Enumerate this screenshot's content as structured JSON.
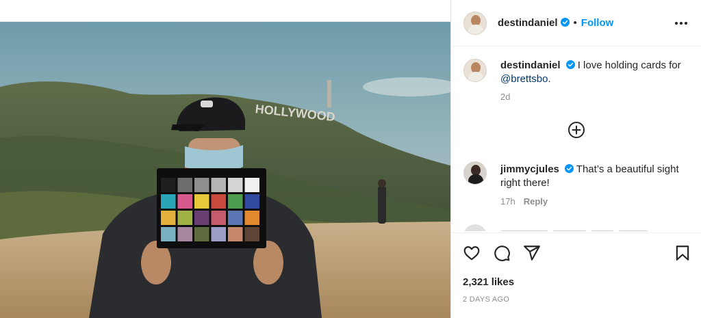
{
  "post": {
    "author": "destindaniel",
    "follow_label": "Follow",
    "separator": "•",
    "photo_sign_text": "HOLLYWOOD"
  },
  "caption": {
    "username": "destindaniel",
    "text": "I love holding cards for",
    "mention": "@brettsbo",
    "end": ".",
    "time": "2d"
  },
  "comments": [
    {
      "username": "jimmycjules",
      "text": "That’s a beautiful sight right there!",
      "time": "17h",
      "reply_label": "Reply"
    }
  ],
  "engagement": {
    "likes": "2,321 likes",
    "date": "2 DAYS AGO"
  },
  "icons": {
    "more": "more-options-icon",
    "load_more": "plus-circle-icon",
    "like": "heart-icon",
    "comment": "comment-icon",
    "share": "share-icon",
    "save": "bookmark-icon",
    "verified": "verified-badge-icon"
  },
  "colors": {
    "link": "#0095f6",
    "mention": "#00376b",
    "verified": "#0095f6",
    "muted": "#8e8e8e"
  },
  "color_chart": {
    "swatches": [
      [
        "#1f1f1f",
        "#6c6c6c",
        "#8e8e8e",
        "#b5b5b5",
        "#d5d5d5",
        "#f0f0f0"
      ],
      [
        "#2aa6b8",
        "#d8598d",
        "#e6c93a",
        "#c94a3d",
        "#4d9c4f",
        "#2f4a9e"
      ],
      [
        "#e3b13b",
        "#a0b246",
        "#6a3f73",
        "#c55c6e",
        "#5b78b5",
        "#e0892f"
      ],
      [
        "#79b0c2",
        "#a7879f",
        "#5d6b3e",
        "#9d9fc8",
        "#c6876b",
        "#5e4434"
      ]
    ]
  }
}
